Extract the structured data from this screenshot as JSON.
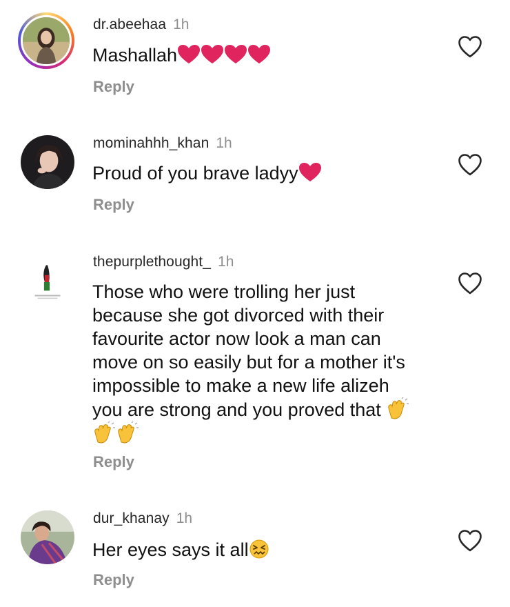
{
  "comments": [
    {
      "username": "dr.abeehaa",
      "time": "1h",
      "text": "Mashallah",
      "emojis": [
        "red-heart",
        "red-heart",
        "red-heart",
        "red-heart"
      ],
      "reply_label": "Reply",
      "avatar_ring": true
    },
    {
      "username": "mominahhh_khan",
      "time": "1h",
      "text": "Proud of you brave ladyy",
      "emojis": [
        "red-heart"
      ],
      "reply_label": "Reply",
      "avatar_ring": false
    },
    {
      "username": "thepurplethought_",
      "time": "1h",
      "text_lines": [
        "Those who were trolling her just",
        "because she got divorced with their",
        "favourite actor now look a man can",
        "move on so easily but for a mother it's",
        "impossible to make a new life alizeh",
        "you are strong and you proved that"
      ],
      "emojis": [
        "clapping-hands",
        "clapping-hands",
        "clapping-hands"
      ],
      "reply_label": "Reply",
      "avatar_ring": false
    },
    {
      "username": "dur_khanay",
      "time": "1h",
      "text": "Her eyes says it all",
      "emojis": [
        "confounded-face"
      ],
      "reply_label": "Reply",
      "avatar_ring": false
    }
  ],
  "colors": {
    "username": "#262626",
    "muted": "#8e8e8e",
    "heart_red": "#e0245e",
    "clap_yellow": "#f8c23a"
  },
  "icons": {
    "like": "heart-outline-icon"
  }
}
